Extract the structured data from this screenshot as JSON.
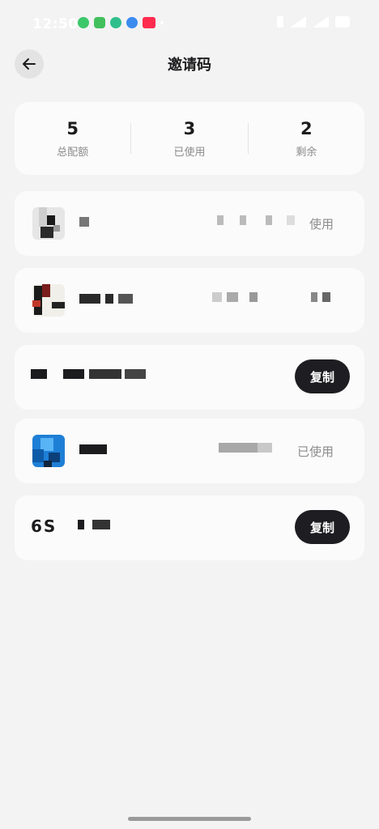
{
  "status_bar": {
    "time": "12:50",
    "notification_icons": [
      "wechat-icon",
      "app-grid-icon",
      "leaf-app-icon",
      "browser-icon",
      "news-app-icon"
    ],
    "system_icons": [
      "bluetooth-icon",
      "signal-icon",
      "signal-icon",
      "battery-icon"
    ]
  },
  "header": {
    "title": "邀请码",
    "back_icon": "arrow-left-icon"
  },
  "summary": {
    "total": {
      "value": "5",
      "label": "总配额"
    },
    "used": {
      "value": "3",
      "label": "已使用"
    },
    "remaining": {
      "value": "2",
      "label": "剩余"
    }
  },
  "codes": [
    {
      "status": "使用",
      "action": ""
    },
    {
      "status": "",
      "action": ""
    },
    {
      "status": "",
      "action": "复制"
    },
    {
      "status": "已使用",
      "action": ""
    },
    {
      "code": "6S",
      "status": "",
      "action": "复制"
    }
  ],
  "colors": {
    "background": "#f3f3f3",
    "card": "#fbfbfb",
    "button": "#1e1e22",
    "muted_text": "#8c8c8c"
  }
}
